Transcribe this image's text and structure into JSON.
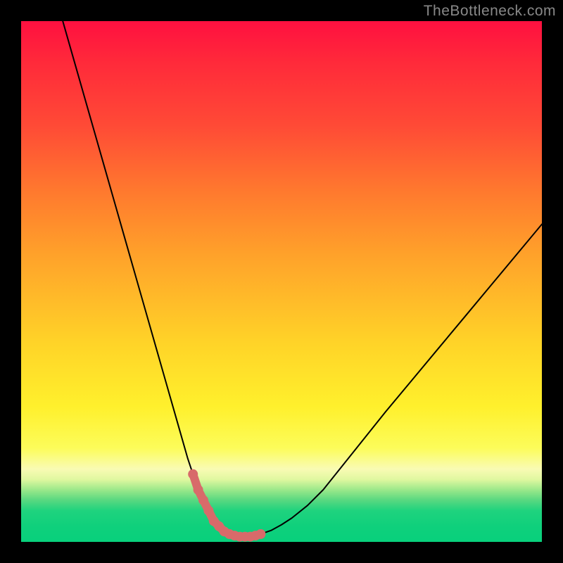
{
  "watermark": "TheBottleneck.com",
  "chart_data": {
    "type": "line",
    "title": "",
    "xlabel": "",
    "ylabel": "",
    "xlim": [
      0,
      100
    ],
    "ylim": [
      0,
      100
    ],
    "grid": false,
    "series": [
      {
        "name": "curve",
        "x": [
          8,
          10,
          12,
          14,
          16,
          18,
          20,
          22,
          24,
          26,
          28,
          30,
          32,
          33,
          34,
          35,
          36,
          37,
          38,
          39,
          40,
          41,
          42,
          43,
          44,
          45,
          46,
          48,
          50,
          52,
          55,
          58,
          62,
          66,
          70,
          75,
          80,
          85,
          90,
          95,
          100
        ],
        "values": [
          100,
          93,
          86,
          79,
          72,
          65,
          58,
          51,
          44,
          37,
          30,
          23,
          16,
          13,
          10,
          8,
          6,
          4,
          3,
          2,
          1.5,
          1.2,
          1,
          1,
          1,
          1.2,
          1.5,
          2.2,
          3.3,
          4.6,
          7,
          10,
          15,
          20,
          25,
          31,
          37,
          43,
          49,
          55,
          61
        ]
      }
    ],
    "valley_marker": {
      "x_start": 33,
      "x_end": 47,
      "y": 2
    },
    "gradient_stops": [
      {
        "pos": 0,
        "color": "#ff1040"
      },
      {
        "pos": 20,
        "color": "#ff4a36"
      },
      {
        "pos": 45,
        "color": "#ffa22a"
      },
      {
        "pos": 74,
        "color": "#fff02c"
      },
      {
        "pos": 88,
        "color": "#e0f8a0"
      },
      {
        "pos": 94,
        "color": "#1fd37e"
      },
      {
        "pos": 100,
        "color": "#08d07c"
      }
    ]
  }
}
